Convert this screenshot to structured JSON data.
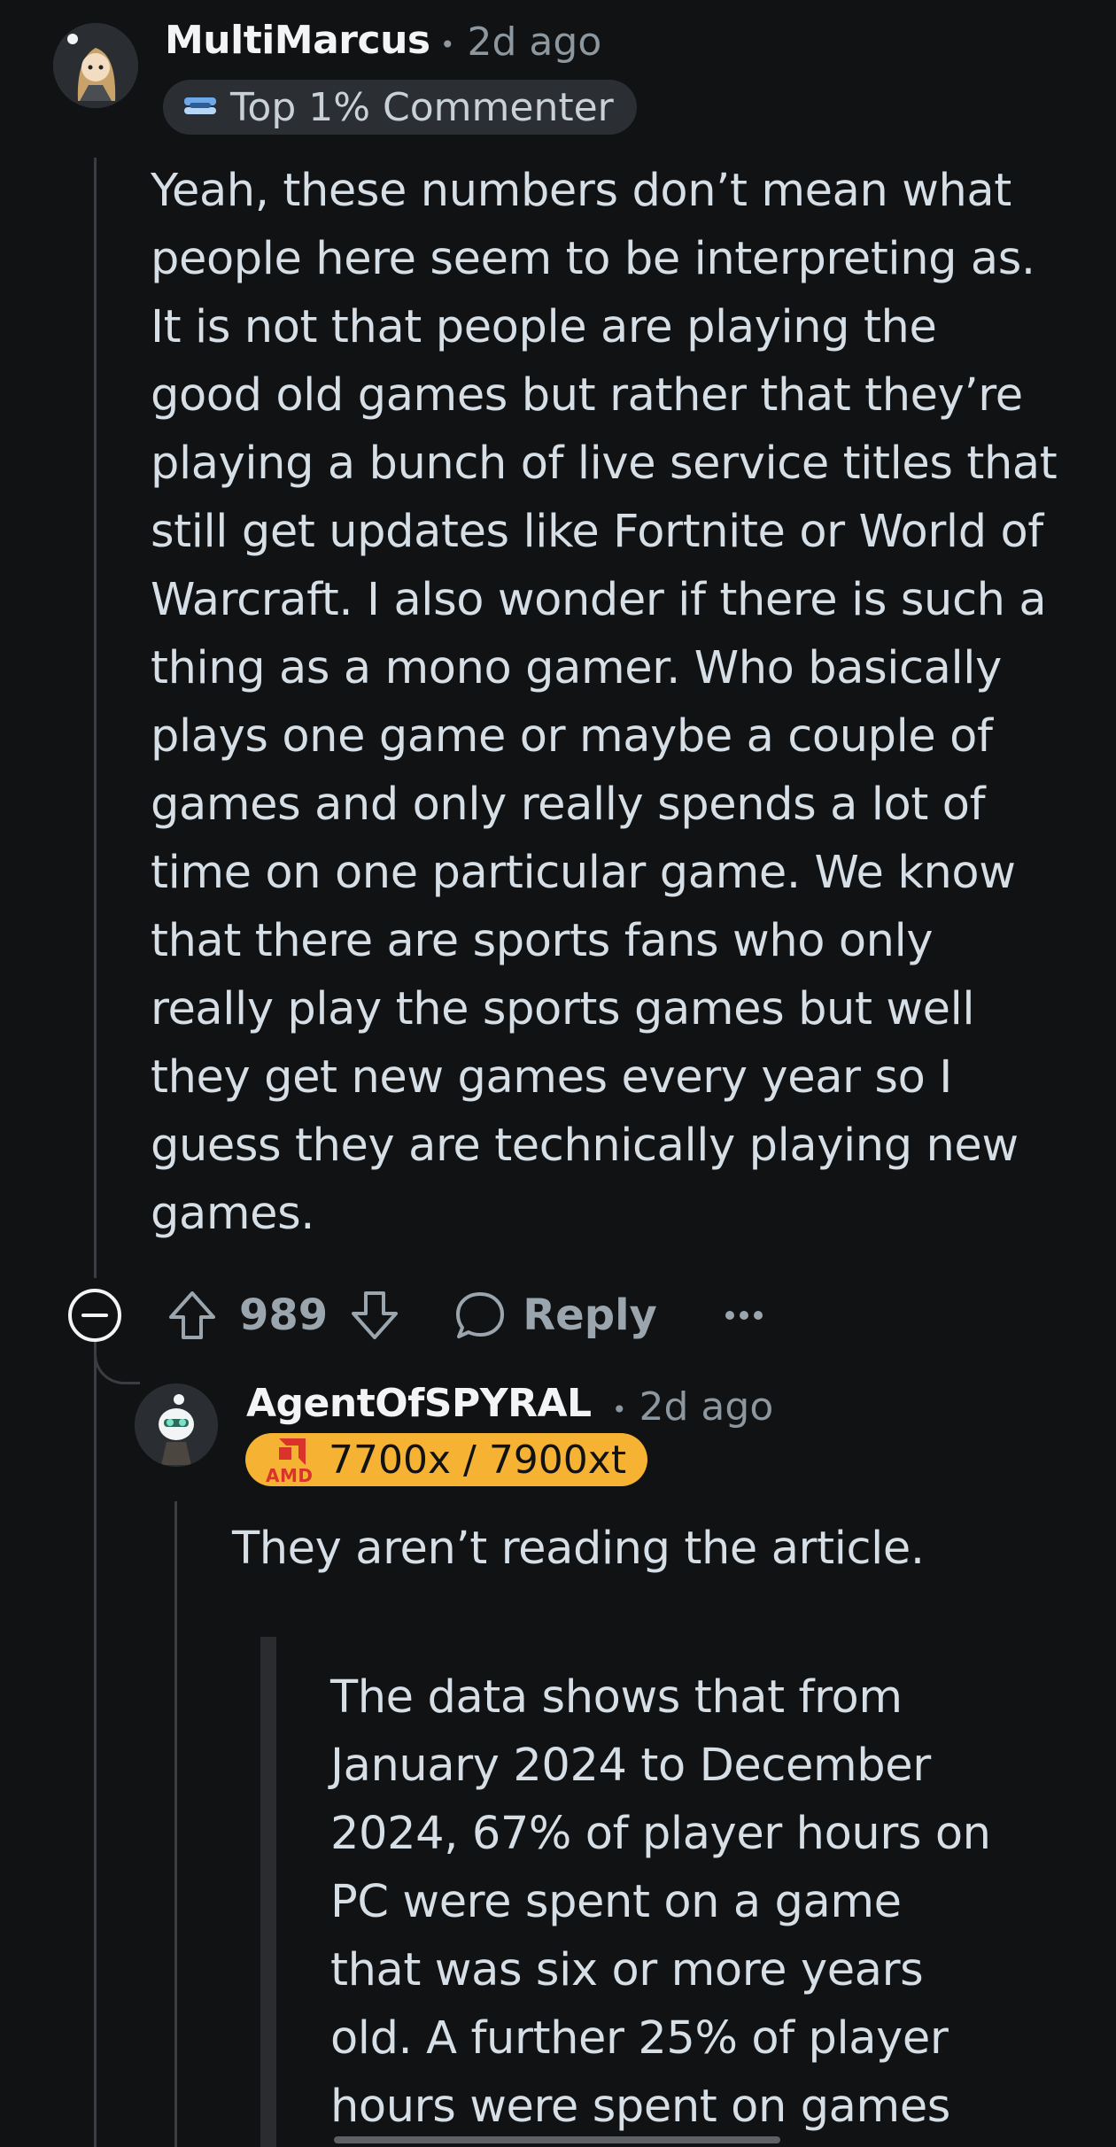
{
  "comment": {
    "username": "MultiMarcus",
    "time": "2d ago",
    "flair_text": "Top 1% Commenter",
    "body_lines": [
      "Yeah, these numbers don’t mean what",
      "people here seem to be interpreting as.",
      "It is not that people are playing the",
      "good old games but rather that they’re",
      "playing a bunch of live service titles that",
      "still get updates like Fortnite or World of",
      "Warcraft. I also wonder if there is such a",
      "thing as a mono gamer. Who basically",
      "plays one game or maybe a couple of",
      "games and only really spends a lot of",
      "time on one particular game. We know",
      "that there are sports fans who only",
      "really play the sports games but well",
      "they get new games every year so I",
      "guess they are technically playing new",
      "games."
    ],
    "vote_count": "989",
    "reply_label": "Reply"
  },
  "reply": {
    "username": "AgentOfSPYRAL",
    "time": "2d ago",
    "flair_logo": "AMD",
    "flair_text": "7700x / 7900xt",
    "body": "They aren’t reading the article.",
    "quote_lines": [
      "The data shows that from",
      "January 2024 to December",
      "2024, 67% of player hours on",
      "PC were spent on a game",
      "that was six or more years",
      "old. A further 25% of player",
      "hours were spent on games"
    ]
  },
  "colors": {
    "background": "#111214",
    "amd_flair": "#f6b333",
    "thread_line": "#3a3d41"
  },
  "icons": [
    "collapse-icon",
    "upvote-icon",
    "downvote-icon",
    "reply-bubble-icon",
    "more-options-icon",
    "top-commenter-badge-icon",
    "amd-logo-icon"
  ]
}
